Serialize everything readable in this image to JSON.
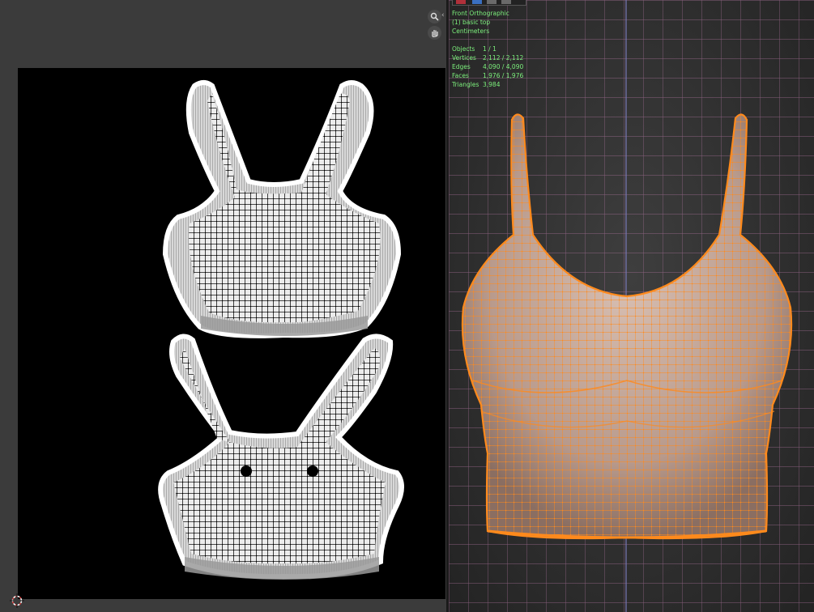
{
  "viewport": {
    "view_name": "Front Orthographic",
    "object_name": "(1) basic top",
    "units": "Centimeters",
    "stats": [
      {
        "label": "Objects",
        "value": "1 / 1"
      },
      {
        "label": "Vertices",
        "value": "2,112 / 2,112"
      },
      {
        "label": "Edges",
        "value": "4,090 / 4,090"
      },
      {
        "label": "Faces",
        "value": "1,976 / 1,976"
      },
      {
        "label": "Triangles",
        "value": "3,984"
      }
    ]
  },
  "icons": {
    "zoom": "zoom-icon",
    "pan": "hand-pan-icon",
    "cursor": "3d-cursor-icon",
    "arrow": "chevron-left-icon"
  },
  "colors": {
    "uv_background": "#000000",
    "editor_background": "#3b3b3b",
    "wire_selected": "#ff8a1c",
    "grid_line": "#b07aa0",
    "stats_text": "#7cf07c"
  },
  "nav": {
    "arrow_glyph": "‹"
  }
}
